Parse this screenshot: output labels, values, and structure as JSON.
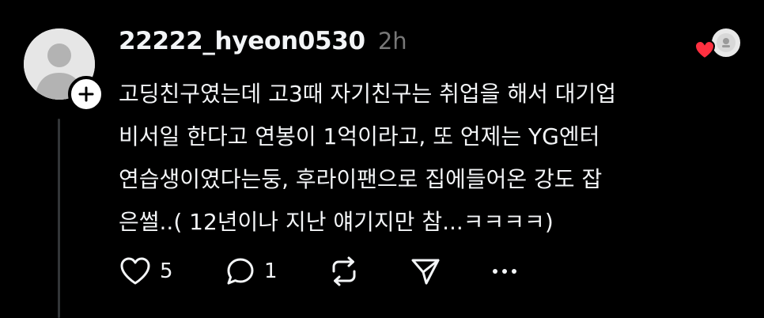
{
  "post": {
    "username": "22222_hyeon0530",
    "timestamp": "2h",
    "body_lines": [
      "고딩친구였는데 고3때 자기친구는 취업을 해서 대기업",
      "비서일 한다고 연봉이 1억이라고, 또 언제는 YG엔터",
      "연습생이였다는둥, 후라이팬으로 집에들어온 강도 잡",
      "은썰..( 12년이나 지난 얘기지만 참...ㅋㅋㅋㅋ)"
    ],
    "actions": {
      "like": {
        "icon": "heart-outline-icon",
        "count": "5"
      },
      "reply": {
        "icon": "comment-icon",
        "count": "1"
      },
      "repost": {
        "icon": "repost-icon"
      },
      "share": {
        "icon": "send-icon"
      },
      "more": {
        "icon": "more-horizontal-icon"
      }
    }
  },
  "colors": {
    "background": "#000000",
    "text": "#f3f5f7",
    "muted": "#777777",
    "heart": "#ff3040",
    "avatar_bg": "#e6e6e6",
    "thread_line": "#333638"
  }
}
